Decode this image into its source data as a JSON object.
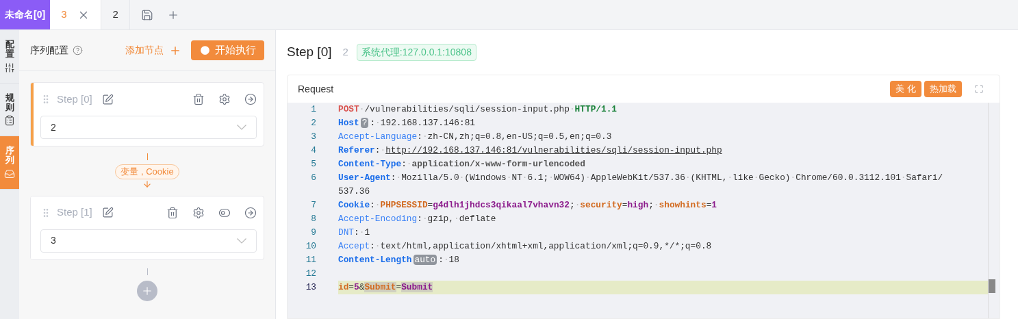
{
  "tab_group": {
    "label": "未命名[0]"
  },
  "tabs": [
    {
      "label": "3",
      "selected": true,
      "closable": true
    },
    {
      "label": "2",
      "selected": false,
      "closable": false
    }
  ],
  "side_tabs": [
    {
      "label": "配置",
      "selected": false
    },
    {
      "label": "规则",
      "selected": false
    },
    {
      "label": "序列",
      "selected": true
    }
  ],
  "sidebar": {
    "title": "序列配置",
    "add_node": "添加节点",
    "run_button": "开始执行",
    "steps": [
      {
        "title": "Step [0]",
        "value": "2",
        "selected": true,
        "toggle": false,
        "link_label": "变量 , Cookie"
      },
      {
        "title": "Step [1]",
        "value": "3",
        "selected": false,
        "toggle": true
      }
    ]
  },
  "main": {
    "title": "Step [0]",
    "count": "2",
    "proxy": "系统代理:127.0.0.1:10808",
    "request": {
      "title": "Request",
      "buttons": [
        "美 化",
        "热加载"
      ],
      "lines": [
        {
          "n": "1",
          "active": false,
          "rows": [
            [
              {
                "kind": "method",
                "text": "POST"
              },
              {
                "kind": "text",
                "text": "·/vulnerabilities/sqli/session-input.php·"
              },
              {
                "kind": "version",
                "text": "HTTP/1.1"
              }
            ]
          ]
        },
        {
          "n": "2",
          "active": false,
          "rows": [
            [
              {
                "kind": "key",
                "text": "Host"
              },
              {
                "kind": "badge",
                "text": "?"
              },
              {
                "kind": "text",
                "text": ":·192.168.137.146:81"
              }
            ]
          ]
        },
        {
          "n": "3",
          "active": false,
          "rows": [
            [
              {
                "kind": "key_light",
                "text": "Accept-Language"
              },
              {
                "kind": "text",
                "text": ":·zh-CN,zh;q=0.8,en-US;q=0.5,en;q=0.3"
              }
            ]
          ]
        },
        {
          "n": "4",
          "active": false,
          "rows": [
            [
              {
                "kind": "key",
                "text": "Referer"
              },
              {
                "kind": "text",
                "text": ":·"
              },
              {
                "kind": "url",
                "text": "http://192.168.137.146:81/vulnerabilities/sqli/session-input.php"
              }
            ]
          ]
        },
        {
          "n": "5",
          "active": false,
          "rows": [
            [
              {
                "kind": "key",
                "text": "Content-Type"
              },
              {
                "kind": "text",
                "text": ":·"
              },
              {
                "kind": "strong",
                "text": "application/x-www-form-urlencoded"
              }
            ]
          ]
        },
        {
          "n": "6",
          "active": false,
          "rows": [
            [
              {
                "kind": "key",
                "text": "User-Agent"
              },
              {
                "kind": "text",
                "text": ":·Mozilla/5.0·(Windows·NT·6.1;·WOW64)·AppleWebKit/537.36·(KHTML,·like·Gecko)·Chrome/60.0.3112.101·Safari/"
              }
            ],
            [
              {
                "kind": "text",
                "text": "537.36"
              }
            ]
          ]
        },
        {
          "n": "7",
          "active": false,
          "rows": [
            [
              {
                "kind": "key",
                "text": "Cookie"
              },
              {
                "kind": "text",
                "text": ":·"
              },
              {
                "kind": "param",
                "text": "PHPSESSID"
              },
              {
                "kind": "text",
                "text": "="
              },
              {
                "kind": "pvalue",
                "text": "g4dlh1jhdcs3qikaal7vhavn32"
              },
              {
                "kind": "text",
                "text": ";·"
              },
              {
                "kind": "param",
                "text": "security"
              },
              {
                "kind": "text",
                "text": "="
              },
              {
                "kind": "pvalue",
                "text": "high"
              },
              {
                "kind": "text",
                "text": ";·"
              },
              {
                "kind": "param",
                "text": "showhints"
              },
              {
                "kind": "text",
                "text": "="
              },
              {
                "kind": "pvalue",
                "text": "1"
              }
            ]
          ]
        },
        {
          "n": "8",
          "active": false,
          "rows": [
            [
              {
                "kind": "key_light",
                "text": "Accept-Encoding"
              },
              {
                "kind": "text",
                "text": ":·gzip,·deflate"
              }
            ]
          ]
        },
        {
          "n": "9",
          "active": false,
          "rows": [
            [
              {
                "kind": "key_light",
                "text": "DNT"
              },
              {
                "kind": "text",
                "text": ":·1"
              }
            ]
          ]
        },
        {
          "n": "10",
          "active": false,
          "rows": [
            [
              {
                "kind": "key_light",
                "text": "Accept"
              },
              {
                "kind": "text",
                "text": ":·text/html,application/xhtml+xml,application/xml;q=0.9,*/*;q=0.8"
              }
            ]
          ]
        },
        {
          "n": "11",
          "active": false,
          "rows": [
            [
              {
                "kind": "key",
                "text": "Content-Length"
              },
              {
                "kind": "badge",
                "text": "auto"
              },
              {
                "kind": "text",
                "text": ":·18"
              }
            ]
          ]
        },
        {
          "n": "12",
          "active": false
        },
        {
          "n": "13",
          "active": true,
          "rows": [
            [
              {
                "kind": "param",
                "text": "id"
              },
              {
                "kind": "text",
                "text": "="
              },
              {
                "kind": "pvalue",
                "text": "5"
              },
              {
                "kind": "text",
                "text": "&"
              },
              {
                "kind": "param",
                "text": "Submit",
                "match": true
              },
              {
                "kind": "text",
                "text": "="
              },
              {
                "kind": "pvalue",
                "text": "Submit",
                "match": true
              }
            ]
          ]
        }
      ]
    }
  }
}
